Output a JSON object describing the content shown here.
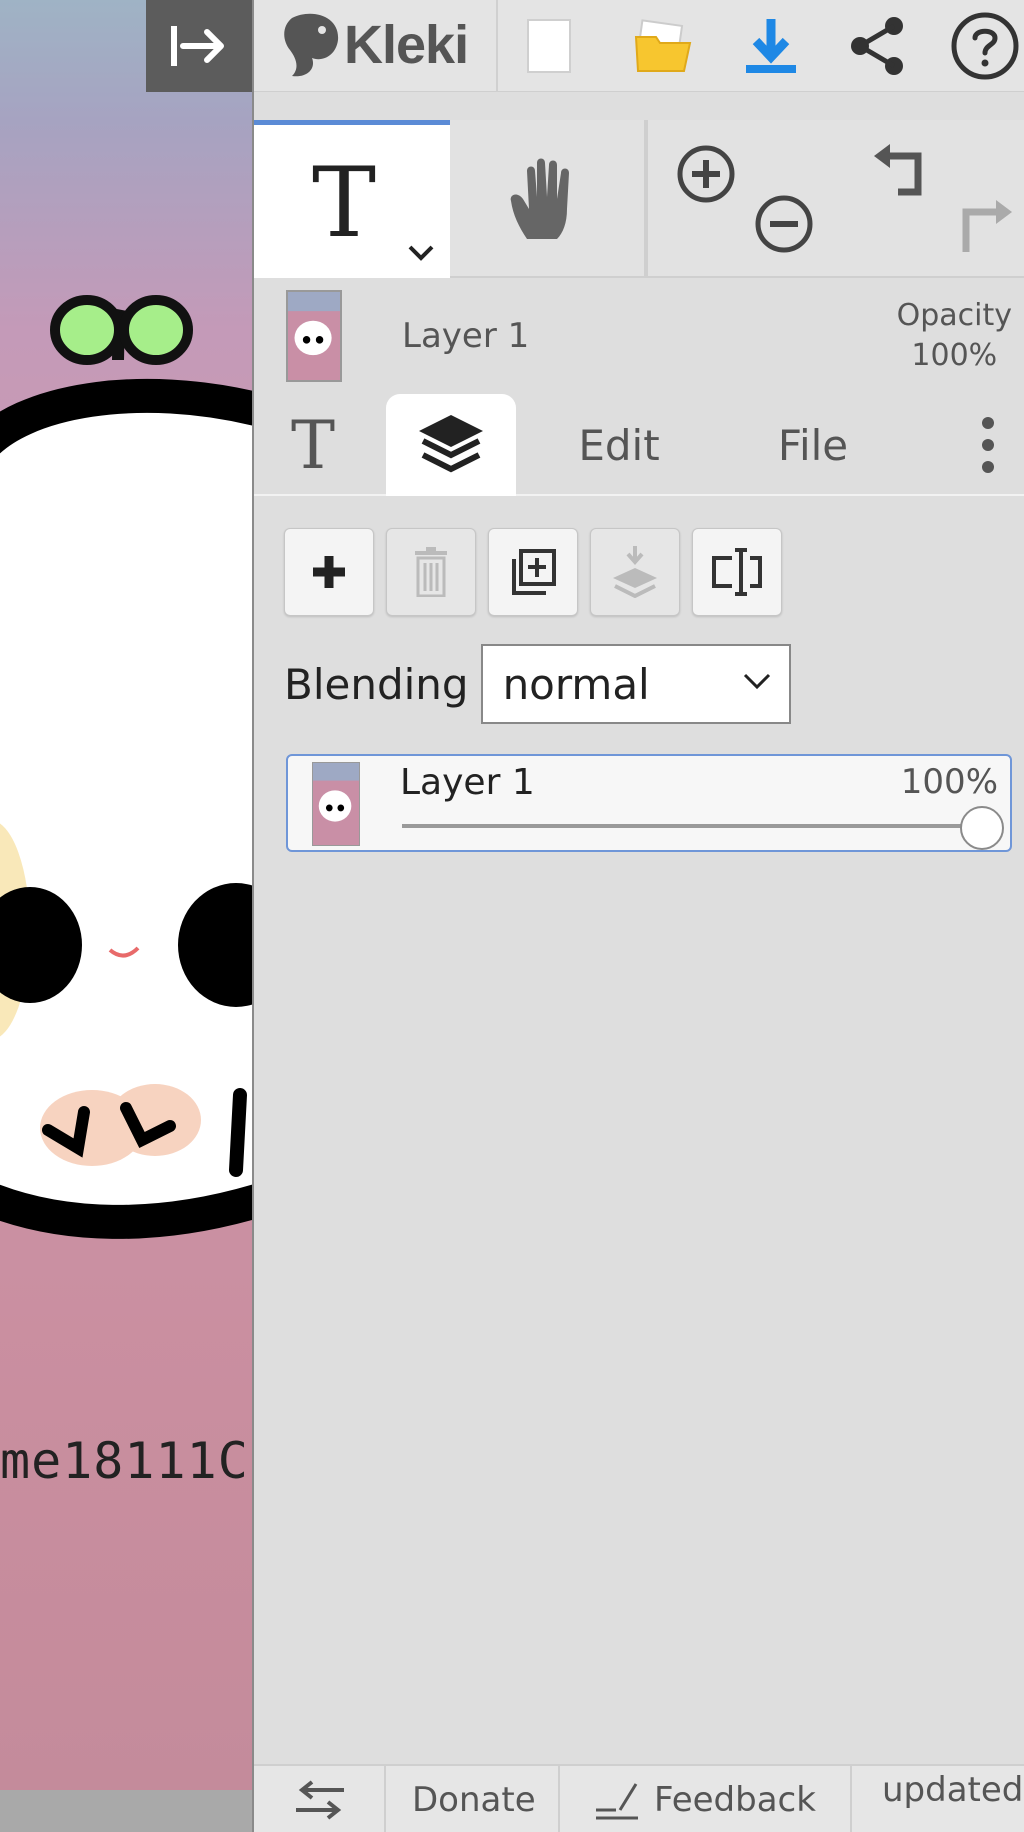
{
  "app": {
    "title": "Kleki"
  },
  "canvas": {
    "caption": "me18111C"
  },
  "topbar": {
    "icons": [
      "new-image-icon",
      "open-folder-icon",
      "download-icon",
      "share-icon",
      "help-icon"
    ]
  },
  "colors": {
    "accent": "#5b8bd6",
    "folder": "#f7c62f",
    "download": "#1e88e5",
    "panel_bg": "#dedede"
  },
  "layer_preview": {
    "name": "Layer 1",
    "opacity_label": "Opacity",
    "opacity_value": "100%"
  },
  "tabs": {
    "edit": "Edit",
    "file": "File"
  },
  "layers_panel": {
    "blending_label": "Blending",
    "blending_value": "normal",
    "layers": [
      {
        "name": "Layer 1",
        "opacity": "100%",
        "opacity_fraction": 1.0
      }
    ]
  },
  "footer": {
    "donate": "Donate",
    "feedback": "Feedback",
    "updated": "updated"
  }
}
